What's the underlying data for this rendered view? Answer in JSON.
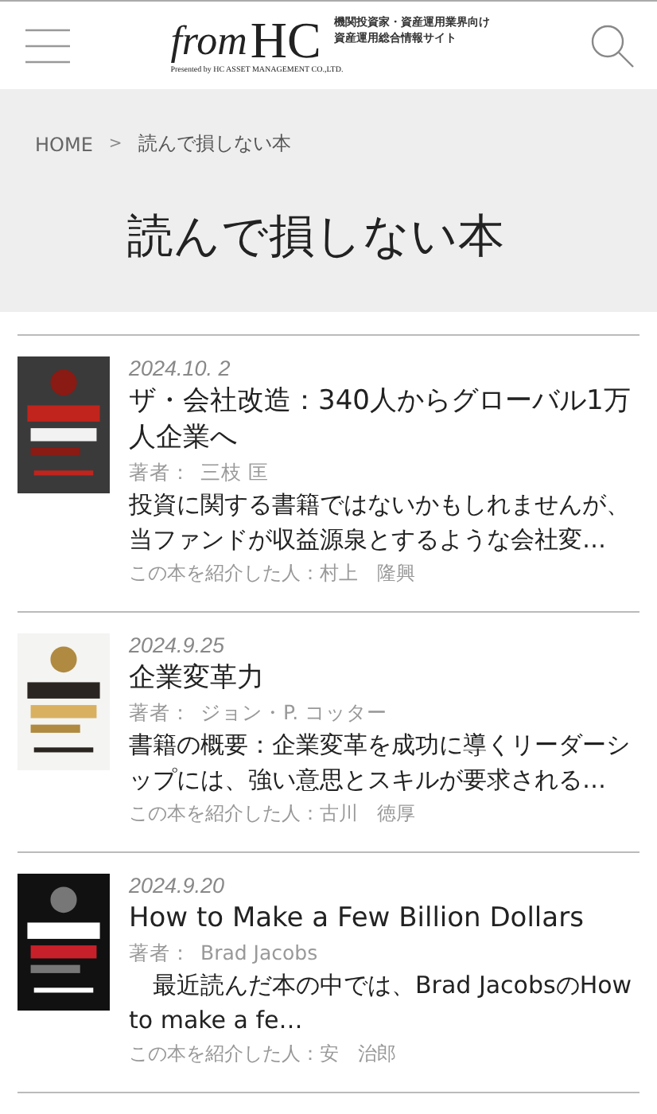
{
  "header": {
    "logo": {
      "word": "from",
      "letters": "HC",
      "presented_by": "Presented by HC ASSET MANAGEMENT CO.,LTD.",
      "tagline": [
        "機関投資家・資産運用業界向け",
        "資産運用総合情報サイト"
      ]
    }
  },
  "breadcrumb": [
    "HOME",
    "読んで損しない本"
  ],
  "breadcrumb_separator": ">",
  "page_title": "読んで損しない本",
  "books": [
    {
      "date": "2024.10. 2",
      "title": "ザ・会社改造：340人からグローバル1万人企業へ",
      "author_label": "著者：",
      "author": "三枝 匡",
      "summary": "投資に関する書籍ではないかもしれませんが、当ファンドが収益源泉とするような会社変…",
      "introducer": "この本を紹介した人：村上　隆興"
    },
    {
      "date": "2024.9.25",
      "title": "企業変革力",
      "author_label": "著者：",
      "author": "ジョン・P. コッター",
      "summary": "書籍の概要：企業変革を成功に導くリーダーシップには、強い意思とスキルが要求される…",
      "introducer": "この本を紹介した人：古川　徳厚"
    },
    {
      "date": "2024.9.20",
      "title": "How to Make a Few Billion Dollars",
      "author_label": "著者：",
      "author": "Brad Jacobs",
      "summary": "　最近読んだ本の中では、Brad JacobsのHow to make a fe…",
      "introducer": "この本を紹介した人：安　治郎"
    }
  ]
}
